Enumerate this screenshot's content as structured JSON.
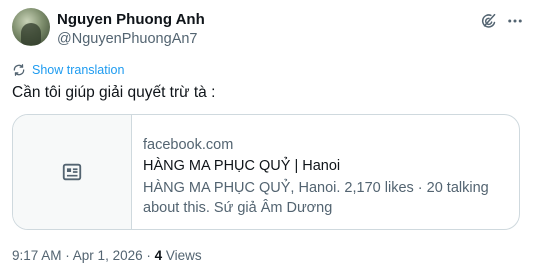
{
  "author": {
    "name": "Nguyen Phuong Anh",
    "handle": "@NguyenPhuongAn7"
  },
  "header_icons": [
    "grok-icon",
    "more-icon"
  ],
  "translation": {
    "label": "Show translation"
  },
  "tweet": {
    "text": "Cần tôi giúp giải quyết trừ tà :"
  },
  "link_card": {
    "icon": "article-icon",
    "domain": "facebook.com",
    "title": "HÀNG MA PHỤC QUỶ | Hanoi",
    "description": "HÀNG MA PHỤC QUỶ, Hanoi. 2,170 likes · 20 talking about this. Sứ giả Âm Dương"
  },
  "meta": {
    "time": "9:17 AM",
    "separator": " · ",
    "date": "Apr 1, 2026",
    "separator2": " · ",
    "views_count": "4",
    "views_label": " Views"
  },
  "colors": {
    "accent": "#1d9bf0",
    "text_primary": "#0f1419",
    "text_secondary": "#536471",
    "border": "#cfd9de"
  }
}
